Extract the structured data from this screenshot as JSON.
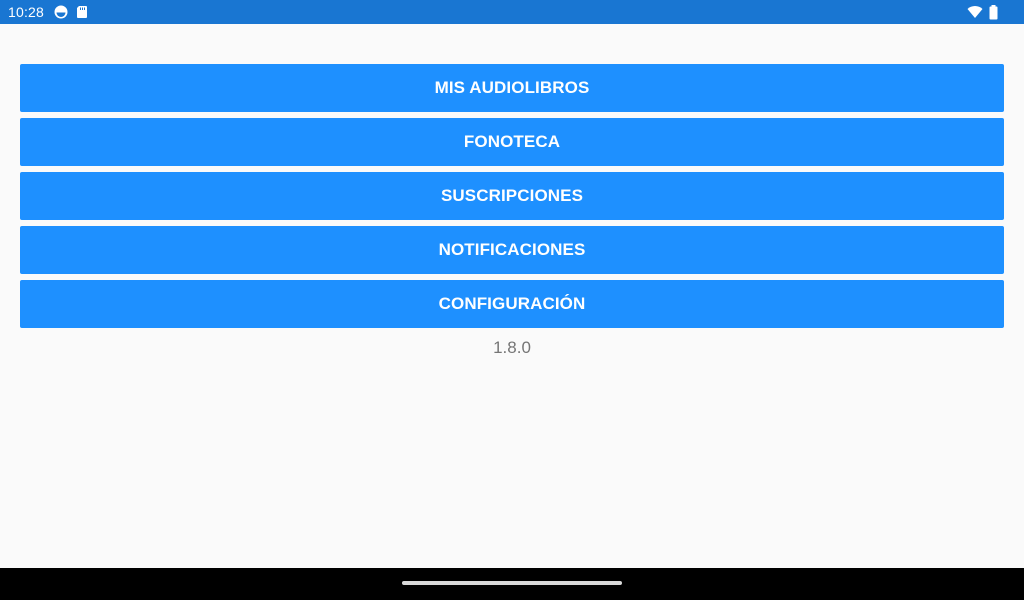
{
  "status_bar": {
    "time": "10:28",
    "icons_left": [
      "sync-icon",
      "sd-card-icon"
    ],
    "icons_right": [
      "wifi-icon",
      "battery-icon"
    ],
    "background": "#1976d2"
  },
  "menu": {
    "items": [
      {
        "label": "MIS AUDIOLIBROS"
      },
      {
        "label": "FONOTECA"
      },
      {
        "label": "SUSCRIPCIONES"
      },
      {
        "label": "NOTIFICACIONES"
      },
      {
        "label": "CONFIGURACIÓN"
      }
    ],
    "button_color": "#1e90ff",
    "text_color": "#ffffff"
  },
  "app_version": "1.8.0",
  "nav_bar": {
    "home_handle": "home-gesture-handle"
  }
}
